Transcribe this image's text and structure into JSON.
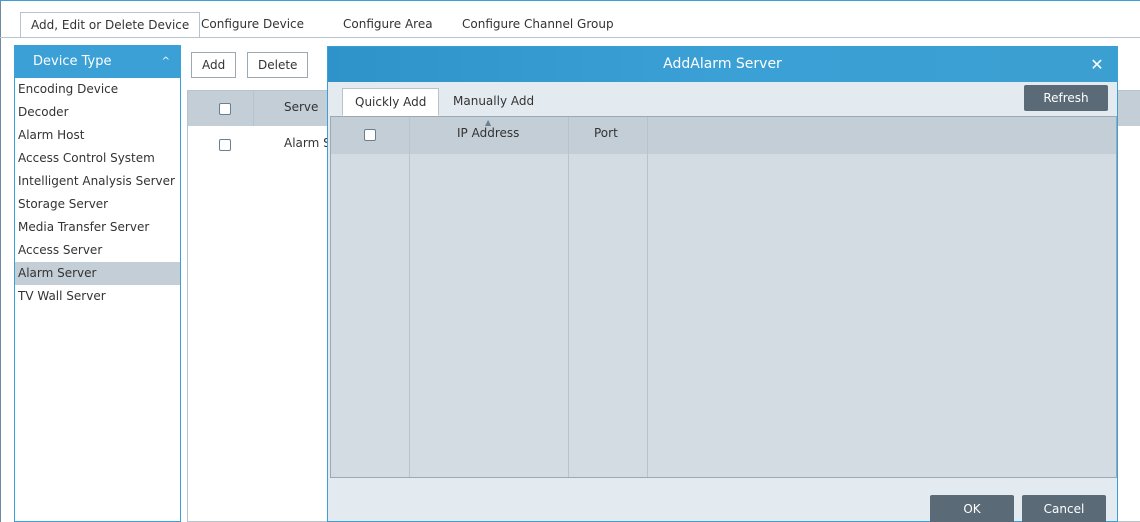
{
  "top_tabs": [
    {
      "label": "Add, Edit or Delete Device",
      "active": true
    },
    {
      "label": "Configure Device",
      "active": false
    },
    {
      "label": "Configure Area",
      "active": false
    },
    {
      "label": "Configure Channel Group",
      "active": false
    }
  ],
  "device_panel": {
    "header": "Device Type",
    "header_icon": "chevron-up-icon",
    "items": [
      {
        "label": "Encoding Device",
        "selected": false
      },
      {
        "label": "Decoder",
        "selected": false
      },
      {
        "label": "Alarm Host",
        "selected": false
      },
      {
        "label": "Access Control System",
        "selected": false
      },
      {
        "label": "Intelligent Analysis Server",
        "selected": false
      },
      {
        "label": "Storage Server",
        "selected": false
      },
      {
        "label": "Media Transfer Server",
        "selected": false
      },
      {
        "label": "Access Server",
        "selected": false
      },
      {
        "label": "Alarm Server",
        "selected": true
      },
      {
        "label": "TV Wall Server",
        "selected": false
      }
    ]
  },
  "toolbar": {
    "add_label": "Add",
    "delete_label": "Delete"
  },
  "device_list": {
    "header_server": "Serve",
    "rows": [
      {
        "name": "Alarm S"
      }
    ]
  },
  "modal": {
    "title": "AddAlarm Server",
    "close_icon": "close-icon",
    "tabs": [
      {
        "label": "Quickly Add",
        "active": true
      },
      {
        "label": "Manually Add",
        "active": false
      }
    ],
    "refresh_label": "Refresh",
    "columns": {
      "ip": "IP Address",
      "port": "Port"
    },
    "ok_label": "OK",
    "cancel_label": "Cancel"
  },
  "colors": {
    "accent": "#3aa0d6",
    "button_dark": "#5a6a77",
    "header_bg": "#c3ced7",
    "selected_bg": "#c3ced7"
  }
}
